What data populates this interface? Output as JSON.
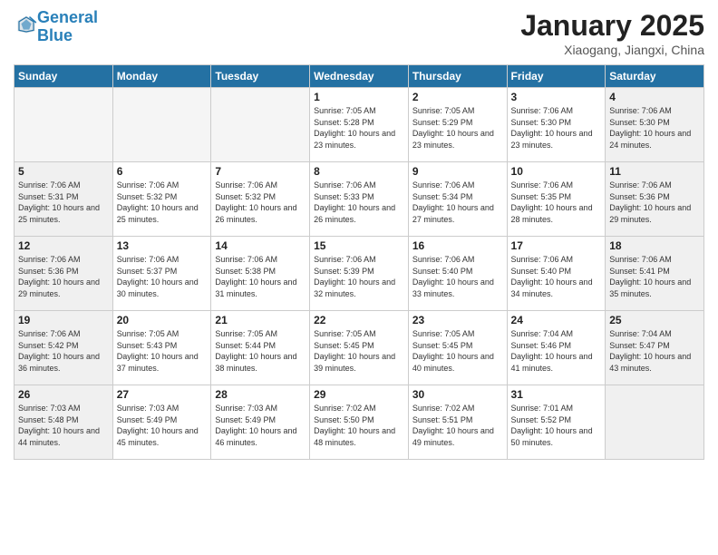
{
  "header": {
    "logo_line1": "General",
    "logo_line2": "Blue",
    "month_title": "January 2025",
    "location": "Xiaogang, Jiangxi, China"
  },
  "weekdays": [
    "Sunday",
    "Monday",
    "Tuesday",
    "Wednesday",
    "Thursday",
    "Friday",
    "Saturday"
  ],
  "weeks": [
    [
      {
        "day": "",
        "info": "",
        "empty": true
      },
      {
        "day": "",
        "info": "",
        "empty": true
      },
      {
        "day": "",
        "info": "",
        "empty": true
      },
      {
        "day": "1",
        "info": "Sunrise: 7:05 AM\nSunset: 5:28 PM\nDaylight: 10 hours\nand 23 minutes."
      },
      {
        "day": "2",
        "info": "Sunrise: 7:05 AM\nSunset: 5:29 PM\nDaylight: 10 hours\nand 23 minutes."
      },
      {
        "day": "3",
        "info": "Sunrise: 7:06 AM\nSunset: 5:30 PM\nDaylight: 10 hours\nand 23 minutes."
      },
      {
        "day": "4",
        "info": "Sunrise: 7:06 AM\nSunset: 5:30 PM\nDaylight: 10 hours\nand 24 minutes.",
        "shaded": true
      }
    ],
    [
      {
        "day": "5",
        "info": "Sunrise: 7:06 AM\nSunset: 5:31 PM\nDaylight: 10 hours\nand 25 minutes.",
        "shaded": true
      },
      {
        "day": "6",
        "info": "Sunrise: 7:06 AM\nSunset: 5:32 PM\nDaylight: 10 hours\nand 25 minutes."
      },
      {
        "day": "7",
        "info": "Sunrise: 7:06 AM\nSunset: 5:32 PM\nDaylight: 10 hours\nand 26 minutes."
      },
      {
        "day": "8",
        "info": "Sunrise: 7:06 AM\nSunset: 5:33 PM\nDaylight: 10 hours\nand 26 minutes."
      },
      {
        "day": "9",
        "info": "Sunrise: 7:06 AM\nSunset: 5:34 PM\nDaylight: 10 hours\nand 27 minutes."
      },
      {
        "day": "10",
        "info": "Sunrise: 7:06 AM\nSunset: 5:35 PM\nDaylight: 10 hours\nand 28 minutes."
      },
      {
        "day": "11",
        "info": "Sunrise: 7:06 AM\nSunset: 5:36 PM\nDaylight: 10 hours\nand 29 minutes.",
        "shaded": true
      }
    ],
    [
      {
        "day": "12",
        "info": "Sunrise: 7:06 AM\nSunset: 5:36 PM\nDaylight: 10 hours\nand 29 minutes.",
        "shaded": true
      },
      {
        "day": "13",
        "info": "Sunrise: 7:06 AM\nSunset: 5:37 PM\nDaylight: 10 hours\nand 30 minutes."
      },
      {
        "day": "14",
        "info": "Sunrise: 7:06 AM\nSunset: 5:38 PM\nDaylight: 10 hours\nand 31 minutes."
      },
      {
        "day": "15",
        "info": "Sunrise: 7:06 AM\nSunset: 5:39 PM\nDaylight: 10 hours\nand 32 minutes."
      },
      {
        "day": "16",
        "info": "Sunrise: 7:06 AM\nSunset: 5:40 PM\nDaylight: 10 hours\nand 33 minutes."
      },
      {
        "day": "17",
        "info": "Sunrise: 7:06 AM\nSunset: 5:40 PM\nDaylight: 10 hours\nand 34 minutes."
      },
      {
        "day": "18",
        "info": "Sunrise: 7:06 AM\nSunset: 5:41 PM\nDaylight: 10 hours\nand 35 minutes.",
        "shaded": true
      }
    ],
    [
      {
        "day": "19",
        "info": "Sunrise: 7:06 AM\nSunset: 5:42 PM\nDaylight: 10 hours\nand 36 minutes.",
        "shaded": true
      },
      {
        "day": "20",
        "info": "Sunrise: 7:05 AM\nSunset: 5:43 PM\nDaylight: 10 hours\nand 37 minutes."
      },
      {
        "day": "21",
        "info": "Sunrise: 7:05 AM\nSunset: 5:44 PM\nDaylight: 10 hours\nand 38 minutes."
      },
      {
        "day": "22",
        "info": "Sunrise: 7:05 AM\nSunset: 5:45 PM\nDaylight: 10 hours\nand 39 minutes."
      },
      {
        "day": "23",
        "info": "Sunrise: 7:05 AM\nSunset: 5:45 PM\nDaylight: 10 hours\nand 40 minutes."
      },
      {
        "day": "24",
        "info": "Sunrise: 7:04 AM\nSunset: 5:46 PM\nDaylight: 10 hours\nand 41 minutes."
      },
      {
        "day": "25",
        "info": "Sunrise: 7:04 AM\nSunset: 5:47 PM\nDaylight: 10 hours\nand 43 minutes.",
        "shaded": true
      }
    ],
    [
      {
        "day": "26",
        "info": "Sunrise: 7:03 AM\nSunset: 5:48 PM\nDaylight: 10 hours\nand 44 minutes.",
        "shaded": true
      },
      {
        "day": "27",
        "info": "Sunrise: 7:03 AM\nSunset: 5:49 PM\nDaylight: 10 hours\nand 45 minutes."
      },
      {
        "day": "28",
        "info": "Sunrise: 7:03 AM\nSunset: 5:49 PM\nDaylight: 10 hours\nand 46 minutes."
      },
      {
        "day": "29",
        "info": "Sunrise: 7:02 AM\nSunset: 5:50 PM\nDaylight: 10 hours\nand 48 minutes."
      },
      {
        "day": "30",
        "info": "Sunrise: 7:02 AM\nSunset: 5:51 PM\nDaylight: 10 hours\nand 49 minutes."
      },
      {
        "day": "31",
        "info": "Sunrise: 7:01 AM\nSunset: 5:52 PM\nDaylight: 10 hours\nand 50 minutes."
      },
      {
        "day": "",
        "info": "",
        "empty": true,
        "shaded": true
      }
    ]
  ]
}
